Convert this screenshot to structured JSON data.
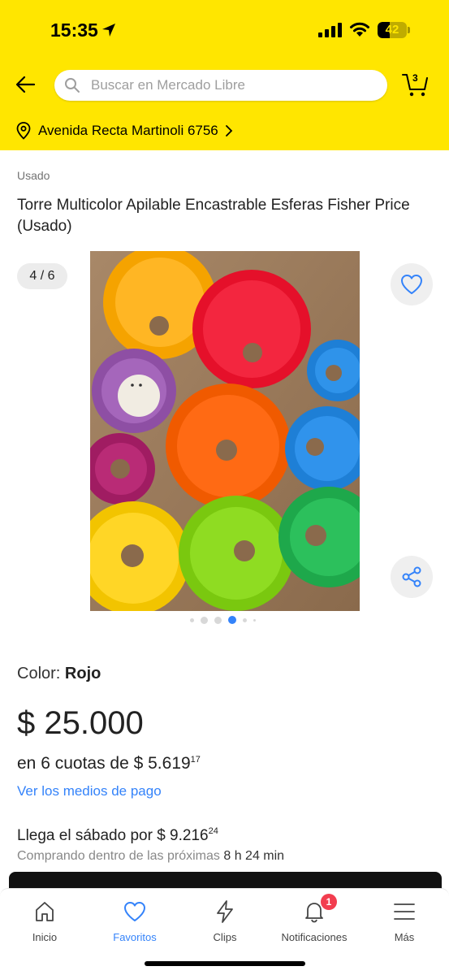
{
  "status_bar": {
    "time": "15:35",
    "battery": "42",
    "battery_level": 0.42
  },
  "header": {
    "search_placeholder": "Buscar en Mercado Libre",
    "cart_count": "3",
    "address": "Avenida Recta Martinoli 6756"
  },
  "product": {
    "condition": "Usado",
    "title": "Torre Multicolor Apilable Encastrable Esferas Fisher Price (Usado)",
    "image_counter": "4 / 6",
    "color_label": "Color:",
    "color_value": "Rojo",
    "price": "$ 25.000",
    "installments_text": "en 6 cuotas de $ 5.619",
    "installments_cents": "17",
    "payment_link": "Ver los medios de pago",
    "shipping_text": "Llega el sábado por $ 9.216",
    "shipping_cents": "24",
    "shipping_sub": "Comprando dentro de las próximas",
    "shipping_time": "8 h 24 min"
  },
  "tabs": [
    {
      "label": "Inicio",
      "icon": "home-icon"
    },
    {
      "label": "Favoritos",
      "icon": "heart-icon",
      "active": true
    },
    {
      "label": "Clips",
      "icon": "lightning-icon"
    },
    {
      "label": "Notificaciones",
      "icon": "bell-icon",
      "badge": "1"
    },
    {
      "label": "Más",
      "icon": "menu-icon"
    }
  ],
  "colors": {
    "header": "#ffe600",
    "accent": "#3483fa",
    "badge": "#f23d4f"
  }
}
